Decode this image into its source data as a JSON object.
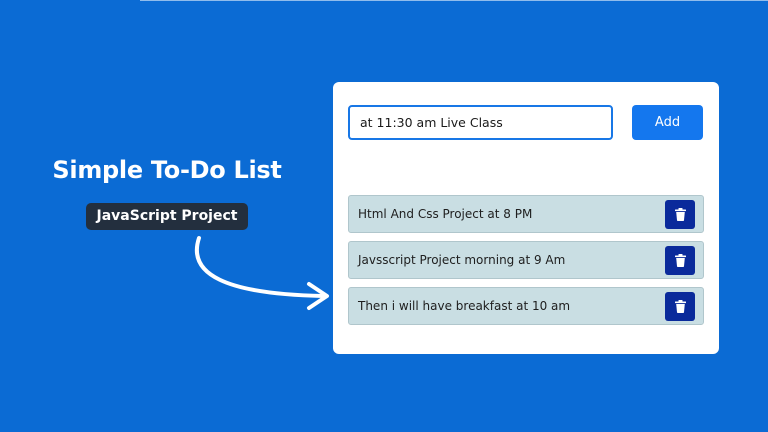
{
  "hero": {
    "title": "Simple To-Do List",
    "badge": "JavaScript Project"
  },
  "todo": {
    "input_value": "at 11:30 am Live Class",
    "add_label": "Add",
    "tasks": [
      {
        "text": "Html And Css Project at 8 PM"
      },
      {
        "text": "Javsscript Project morning at 9 Am"
      },
      {
        "text": "Then i will have breakfast at 10 am"
      }
    ]
  },
  "colors": {
    "background": "#0b6bd4",
    "add_button": "#1477ee",
    "delete_button": "#0a2a9b",
    "task_background": "#c9dee3",
    "badge": "#232f3e"
  },
  "icons": {
    "delete": "trash-icon",
    "pointer": "curved-arrow-icon"
  }
}
